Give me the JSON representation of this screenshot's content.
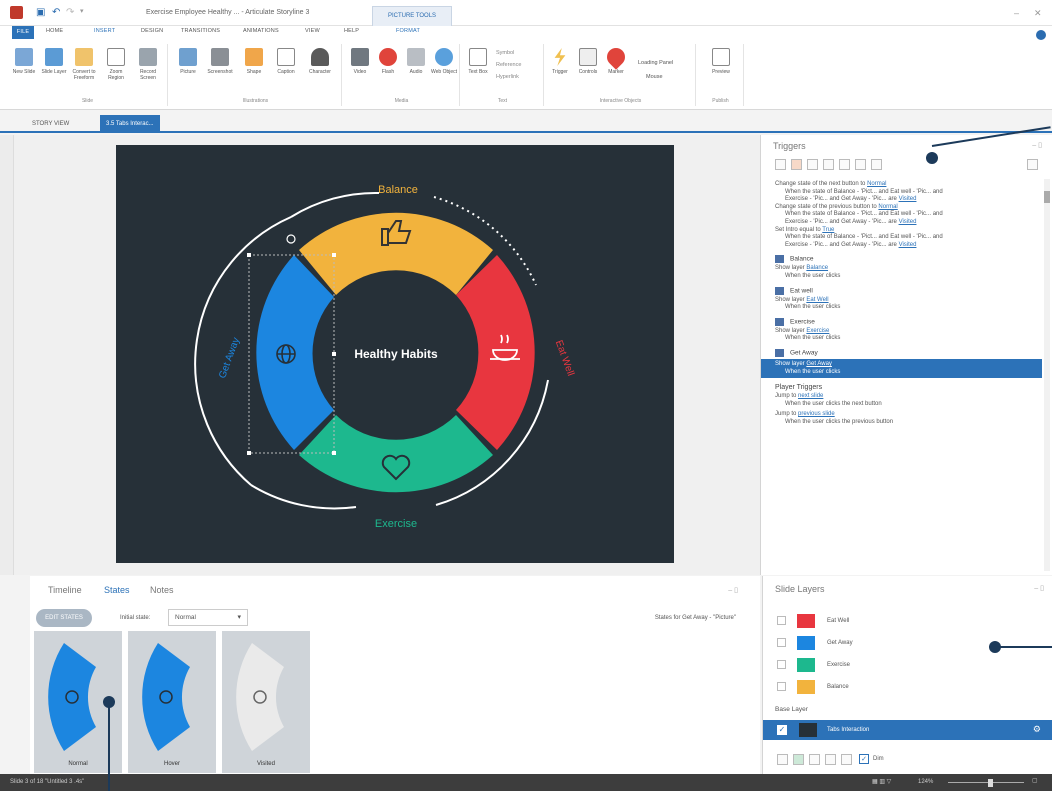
{
  "titlebar": {
    "title": "Exercise Employee Healthy ... - Articulate Storyline 3",
    "context_tab": "PICTURE TOOLS",
    "context_subtab": "FORMAT"
  },
  "ribbon_tabs": [
    "FILE",
    "HOME",
    "INSERT",
    "DESIGN",
    "TRANSITIONS",
    "ANIMATIONS",
    "VIEW",
    "HELP"
  ],
  "ribbon_groups": {
    "slide": {
      "label": "Slide",
      "buttons": [
        "New Slide",
        "Slide Layer",
        "Convert to Freeform",
        "Zoom Region",
        "Record Screen"
      ]
    },
    "illustrations": {
      "label": "Illustrations",
      "buttons": [
        "Picture",
        "Screenshot",
        "Shape",
        "Caption",
        "Character"
      ]
    },
    "media": {
      "label": "Media",
      "buttons": [
        "Video",
        "Flash",
        "Audio",
        "Web Object"
      ]
    },
    "text": {
      "label": "Text",
      "buttons": [
        "Text Box"
      ],
      "options": [
        "Symbol",
        "Reference",
        "Hyperlink"
      ]
    },
    "interactive": {
      "label": "Interactive Objects",
      "buttons": [
        "Trigger",
        "Controls",
        "Marker"
      ],
      "options": [
        "Loading Panel",
        "Mouse"
      ]
    },
    "publish": {
      "label": "Publish",
      "buttons": [
        "Preview"
      ]
    }
  },
  "doc_tabs": {
    "story": "STORY VIEW",
    "slide": "3.5 Tabs Interac..."
  },
  "slide": {
    "center_title": "Healthy Habits",
    "segments": {
      "top": "Balance",
      "right": "Eat Well",
      "bottom": "Exercise",
      "left": "Get Away"
    },
    "colors": {
      "background": "#263038",
      "balance": "#f2b33d",
      "eat_well": "#e8363f",
      "exercise": "#1db88e",
      "get_away": "#1c86e0"
    }
  },
  "triggers": {
    "title": "Triggers",
    "entries": [
      {
        "l1": "Change state of  the next button to ",
        "l1link": "Normal",
        "l2": "When the state of Balance - 'Pict... and Eat well - 'Pic... and",
        "l3": "Exercise - 'Pic... and Get Away - 'Pic... are ",
        "l3link": "Visited"
      },
      {
        "l1": "Change state of  the previous button to ",
        "l1link": "Normal",
        "l2": "When the state of Balance - 'Pict... and Eat well - 'Pic... and",
        "l3": "Exercise - 'Pic... and Get Away - 'Pic... are ",
        "l3link": "Visited"
      },
      {
        "l1": "Set Intro equal to ",
        "l1link": "True",
        "l2": "When the state of Balance - 'Pict... and Eat well - 'Pic... and",
        "l3": "Exercise - 'Pic... and Get Away - 'Pic... are ",
        "l3link": "Visited"
      }
    ],
    "objects": [
      {
        "name": "Balance",
        "action": "Show layer ",
        "link": "Balance",
        "when": "When the user clicks"
      },
      {
        "name": "Eat well",
        "action": "Show layer ",
        "link": "Eat Well",
        "when": "When the user clicks"
      },
      {
        "name": "Exercise",
        "action": "Show layer ",
        "link": "Exercise",
        "when": "When the user clicks"
      },
      {
        "name": "Get Away",
        "action": "Show layer ",
        "link": "Get Away",
        "when": "When the user clicks"
      }
    ],
    "player_title": "Player Triggers",
    "player": [
      {
        "action": "Jump to ",
        "link": "next slide",
        "when": "When the user clicks the next button"
      },
      {
        "action": "Jump to ",
        "link": "previous slide",
        "when": "When the user clicks the previous button"
      }
    ]
  },
  "bottom_tabs": [
    "Timeline",
    "States",
    "Notes"
  ],
  "states": {
    "edit_button": "EDIT STATES",
    "initial_label": "Initial state:",
    "initial_value": "Normal",
    "for_label": "States for Get Away - \"Picture\"",
    "cards": [
      "Normal",
      "Hover",
      "Visited"
    ]
  },
  "slide_layers": {
    "title": "Slide Layers",
    "layers": [
      "Eat Well",
      "Get Away",
      "Exercise",
      "Balance"
    ],
    "base_label": "Base Layer",
    "base_name": "Tabs Interaction",
    "dim_label": "Dim"
  },
  "status": {
    "left": "Slide 3 of 18  \"Untitled 3 .4s\"",
    "zoom": "124%"
  }
}
